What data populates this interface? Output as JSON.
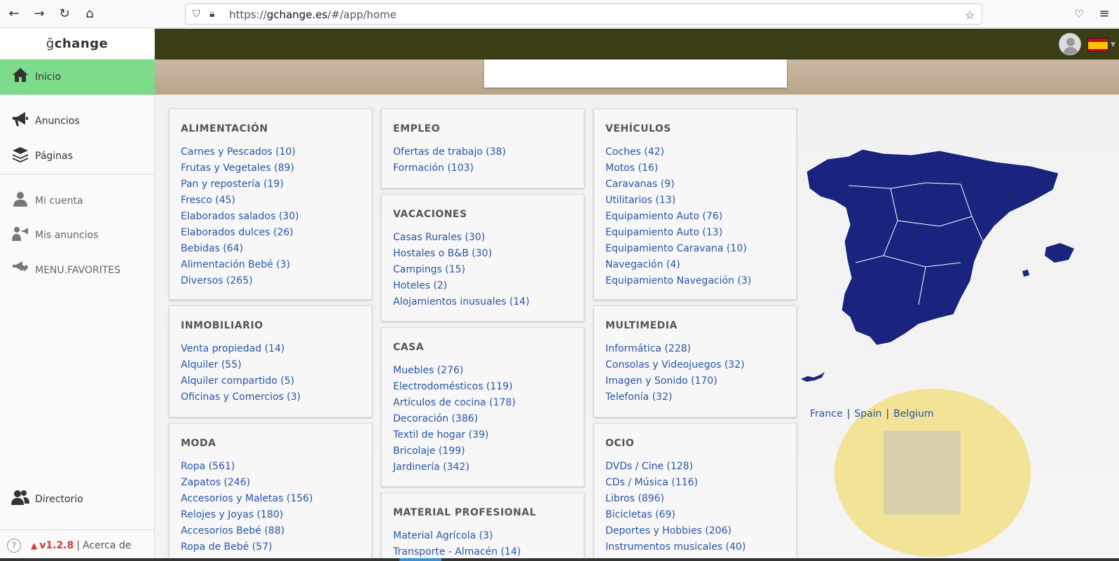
{
  "browser": {
    "url_scheme": "https://",
    "url_host": "gchange.es",
    "url_path": "/#/app/home"
  },
  "sidebar": {
    "brand_g": "ğ",
    "brand_rest": "change",
    "items": [
      {
        "label": "Inicio",
        "icon": "home-icon"
      },
      {
        "label": "Anuncios",
        "icon": "megaphone-icon"
      },
      {
        "label": "Páginas",
        "icon": "layers-icon"
      },
      {
        "label": "Mi cuenta",
        "icon": "user-icon"
      },
      {
        "label": "Mis anuncios",
        "icon": "user-megaphone-icon"
      },
      {
        "label": "MENU.FAVORITES",
        "icon": "favorites-icon"
      },
      {
        "label": "Directorio",
        "icon": "users-icon"
      }
    ],
    "footer": {
      "version": "v1.2.8",
      "separator": "|",
      "about": "Acerca de"
    }
  },
  "categories": {
    "col1": [
      {
        "title": "ALIMENTACIÓN",
        "links": [
          "Carnes y Pescados (10)",
          "Frutas y Vegetales (89)",
          "Pan y repostería (19)",
          "Fresco (45)",
          "Elaborados salados (30)",
          "Elaborados dulces (26)",
          "Bebidas (64)",
          "Alimentación Bebé (3)",
          "Diversos (265)"
        ]
      },
      {
        "title": "INMOBILIARIO",
        "links": [
          "Venta propiedad (14)",
          "Alquiler (55)",
          "Alquiler compartido (5)",
          "Oficinas y Comercios (3)"
        ]
      },
      {
        "title": "MODA",
        "links": [
          "Ropa (561)",
          "Zapatos (246)",
          "Accesorios y Maletas (156)",
          "Relojes y Joyas (180)",
          "Accesorios Bebé (88)",
          "Ropa de Bebé (57)"
        ]
      }
    ],
    "col2": [
      {
        "title": "EMPLEO",
        "links": [
          "Ofertas de trabajo (38)",
          "Formación (103)"
        ]
      },
      {
        "title": "VACACIONES",
        "links": [
          "Casas Rurales (30)",
          "Hostales o B&B (30)",
          "Campings (15)",
          "Hoteles (2)",
          "Alojamientos inusuales (14)"
        ]
      },
      {
        "title": "CASA",
        "links": [
          "Muebles (276)",
          "Electrodomésticos (119)",
          "Artículos de cocina (178)",
          "Decoración (386)",
          "Textil de hogar (39)",
          "Bricolaje (199)",
          "Jardinería (342)"
        ]
      },
      {
        "title": "MATERIAL PROFESIONAL",
        "links": [
          "Material Agrícola (3)",
          "Transporte - Almacén (14)"
        ]
      }
    ],
    "col3": [
      {
        "title": "VEHÍCULOS",
        "links": [
          "Coches (42)",
          "Motos (16)",
          "Caravanas (9)",
          "Utilitarios (13)",
          "Equipamiento Auto (76)",
          "Equipamiento Auto (13)",
          "Equipamiento Caravana (10)",
          "Navegación (4)",
          "Equipamiento Navegación (3)"
        ]
      },
      {
        "title": "MULTIMEDIA",
        "links": [
          "Informática (228)",
          "Consolas y Videojuegos (32)",
          "Imagen y Sonido (170)",
          "Telefonía (32)"
        ]
      },
      {
        "title": "OCIO",
        "links": [
          "DVDs / Cine (128)",
          "CDs / Música (116)",
          "Libros (896)",
          "Bicicletas (69)",
          "Deportes y Hobbies (206)",
          "Instrumentos musicales (40)"
        ]
      }
    ]
  },
  "countries": {
    "france": "France",
    "spain": "Spain",
    "belgium": "Belgium",
    "separator": "|"
  },
  "colors": {
    "header": "#3b3d14",
    "active_nav": "#7ddc8c",
    "link": "#2a53a6",
    "map": "#1a237e"
  }
}
